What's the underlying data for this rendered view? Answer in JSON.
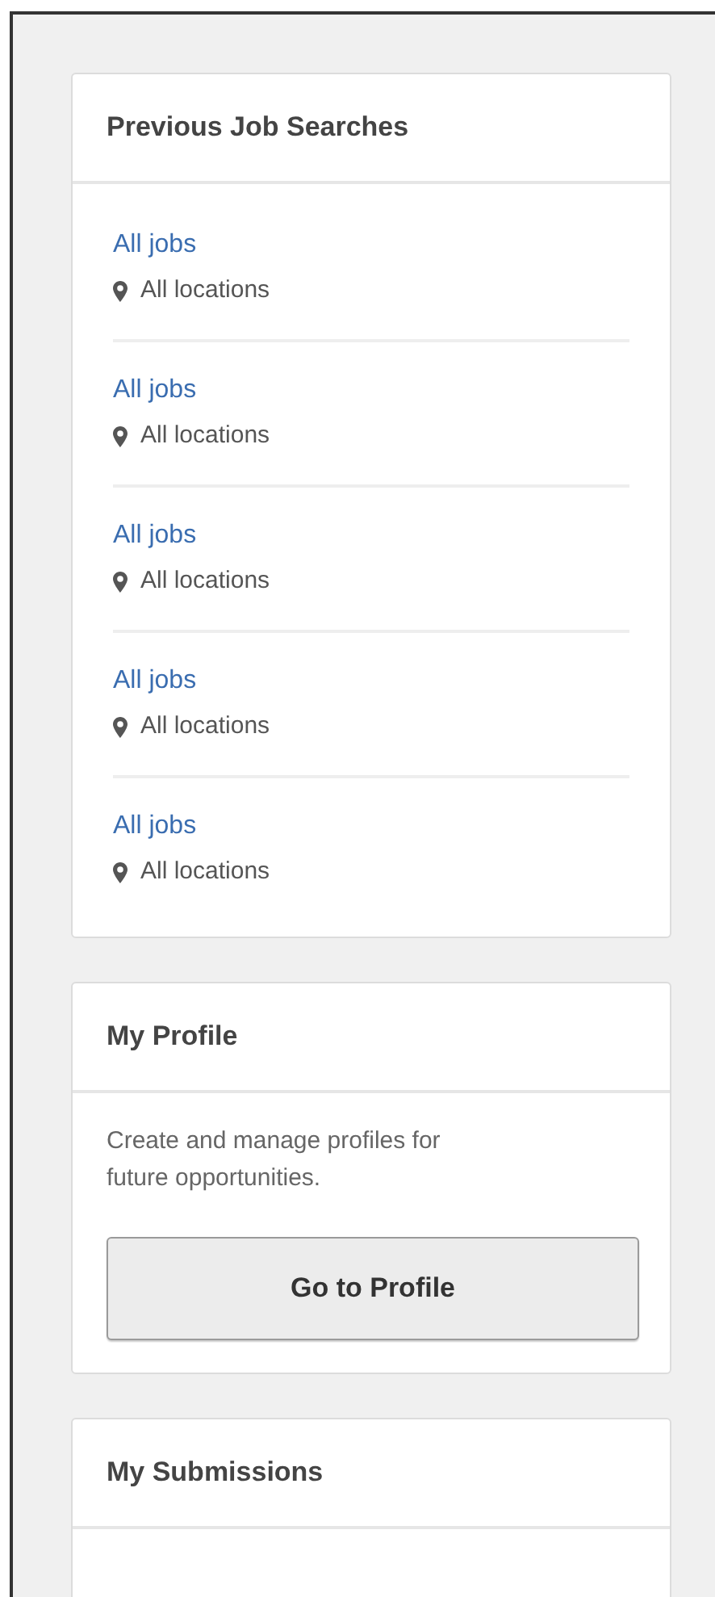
{
  "cards": [
    {
      "kind": "searches",
      "title": "Previous Job Searches",
      "searches": [
        {
          "job": "All jobs",
          "location": "All locations"
        },
        {
          "job": "All jobs",
          "location": "All locations"
        },
        {
          "job": "All jobs",
          "location": "All locations"
        },
        {
          "job": "All jobs",
          "location": "All locations"
        },
        {
          "job": "All jobs",
          "location": "All locations"
        }
      ]
    },
    {
      "kind": "action",
      "title": "My Profile",
      "text": "Create and manage profiles for future opportunities.",
      "button": "Go to Profile"
    },
    {
      "kind": "cut",
      "title": "My Submissions"
    }
  ]
}
